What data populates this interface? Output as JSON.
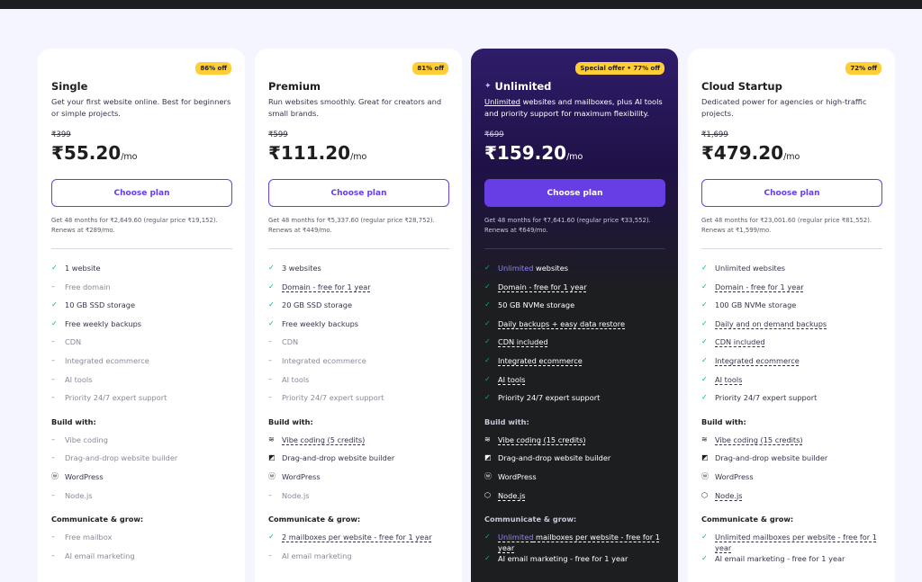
{
  "plans": [
    {
      "badge": "86% off",
      "name": "Single",
      "desc": "Get your first website online. Best for beginners or simple projects.",
      "old_price": "₹399",
      "price": "₹55.20",
      "per": "/mo",
      "button": "Choose plan",
      "note": "Get 48 months for ₹2,649.60 (regular price ₹19,152). Renews at ₹289/mo.",
      "features": [
        "1 website",
        "Free domain",
        "10 GB SSD storage",
        "Free weekly backups",
        "CDN",
        "Integrated ecommerce",
        "AI tools",
        "Priority 24/7 expert support"
      ],
      "build_label": "Build with:",
      "build": [
        "Vibe coding",
        "Drag-and-drop website builder",
        "WordPress",
        "Node.js"
      ],
      "grow_label": "Communicate & grow:",
      "grow": [
        "Free mailbox",
        "AI email marketing"
      ]
    },
    {
      "badge": "81% off",
      "name": "Premium",
      "desc": "Run websites smoothly. Great for creators and small brands.",
      "old_price": "₹599",
      "price": "₹111.20",
      "per": "/mo",
      "button": "Choose plan",
      "note": "Get 48 months for ₹5,337.60 (regular price ₹28,752). Renews at ₹449/mo.",
      "features": [
        "3 websites",
        "Domain - free for 1 year",
        "20 GB SSD storage",
        "Free weekly backups",
        "CDN",
        "Integrated ecommerce",
        "AI tools",
        "Priority 24/7 expert support"
      ],
      "build_label": "Build with:",
      "build": [
        "Vibe coding (5 credits)",
        "Drag-and-drop website builder",
        "WordPress",
        "Node.js"
      ],
      "grow_label": "Communicate & grow:",
      "grow": [
        "2 mailboxes per website - free for 1 year",
        "AI email marketing"
      ]
    },
    {
      "badge": "Special offer • 77% off",
      "name": "Unlimited",
      "desc_hl": "Unlimited",
      "desc": " websites and mailboxes, plus AI tools and priority support for maximum flexibility.",
      "old_price": "₹699",
      "price": "₹159.20",
      "per": "/mo",
      "button": "Choose plan",
      "note": "Get 48 months for ₹7,641.60 (regular price ₹33,552). Renews at ₹649/mo.",
      "feature_hl": "Unlimited",
      "feature_first_rest": " websites",
      "features": [
        "Domain - free for 1 year",
        "50 GB NVMe storage",
        "Daily backups + easy data restore",
        "CDN included",
        "Integrated ecommerce",
        "AI tools",
        "Priority 24/7 expert support"
      ],
      "build_label": "Build with:",
      "build": [
        "Vibe coding (15 credits)",
        "Drag-and-drop website builder",
        "WordPress",
        "Node.js"
      ],
      "grow_label": "Communicate & grow:",
      "grow_hl": "Unlimited",
      "grow_first_rest": " mailboxes per website - free for 1 year",
      "grow": [
        "AI email marketing - free for 1 year"
      ]
    },
    {
      "badge": "72% off",
      "name": "Cloud Startup",
      "desc": "Dedicated power for agencies or high-traffic projects.",
      "old_price": "₹1,699",
      "price": "₹479.20",
      "per": "/mo",
      "button": "Choose plan",
      "note": "Get 48 months for ₹23,001.60 (regular price ₹81,552). Renews at ₹1,599/mo.",
      "features": [
        "Unlimited websites",
        "Domain - free for 1 year",
        "100 GB NVMe storage",
        "Daily and on demand backups",
        "CDN included",
        "Integrated ecommerce",
        "AI tools",
        "Priority 24/7 expert support"
      ],
      "build_label": "Build with:",
      "build": [
        "Vibe coding (15 credits)",
        "Drag-and-drop website builder",
        "WordPress",
        "Node.js"
      ],
      "grow_label": "Communicate & grow:",
      "grow": [
        "Unlimited mailboxes per website - free for 1 year",
        "AI email marketing - free for 1 year"
      ]
    }
  ],
  "colors": {
    "accent": "#673de6",
    "badge": "#ffcd35",
    "check": "#00b090",
    "dark": "#1d1e20"
  },
  "icons": {
    "included": "check-icon",
    "excluded": "dash-icon",
    "vibe": "waves-icon",
    "builder": "builder-icon",
    "wordpress": "wordpress-icon",
    "node": "nodejs-icon",
    "sparkle": "sparkle-icon"
  }
}
